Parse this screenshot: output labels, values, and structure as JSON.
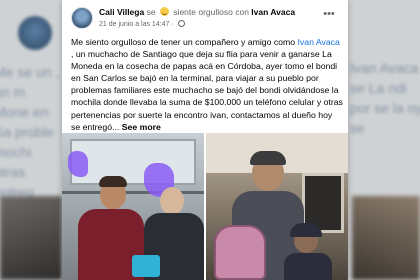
{
  "post": {
    "author": "Cali Villega",
    "feeling_prefix": "se",
    "feeling_text": "siente orgulloso con",
    "tagged": "Ivan Avaca",
    "date": "21 de junio a las 14:47",
    "date_sep": "·",
    "more_menu": "•••",
    "text_before_mention": "Me siento orgulloso de tener un compañero y amigo como",
    "mention": "Ivan Avaca",
    "text_after_mention": ", un muchacho de Santiago que deja su flia para venir a ganarse La Moneda en la cosecha de papas acá en Córdoba, ayer tomo el bondi en San Carlos se bajó en la terminal, para viajar a su pueblo por problemas familiares este muchacho se bajó del bondi olvidándose la mochila donde llevaba la suma de $100.000 un teléfono celular y otras pertenencias por suerte la encontro ivan, contactamos al dueño hoy se entregó...",
    "see_more": "See more"
  },
  "background": {
    "left_text": "Me se un , un m Mone en Sa proble mochi otras entreg",
    "right_text": "Ivan Avaca se La ndi por se la oy se"
  },
  "colors": {
    "mention": "#1b74e4",
    "meta": "#65676b",
    "text": "#050505"
  },
  "icons": {
    "globe": "globe-icon",
    "more": "more-options-icon",
    "emoji": "proud-emoji-icon"
  }
}
